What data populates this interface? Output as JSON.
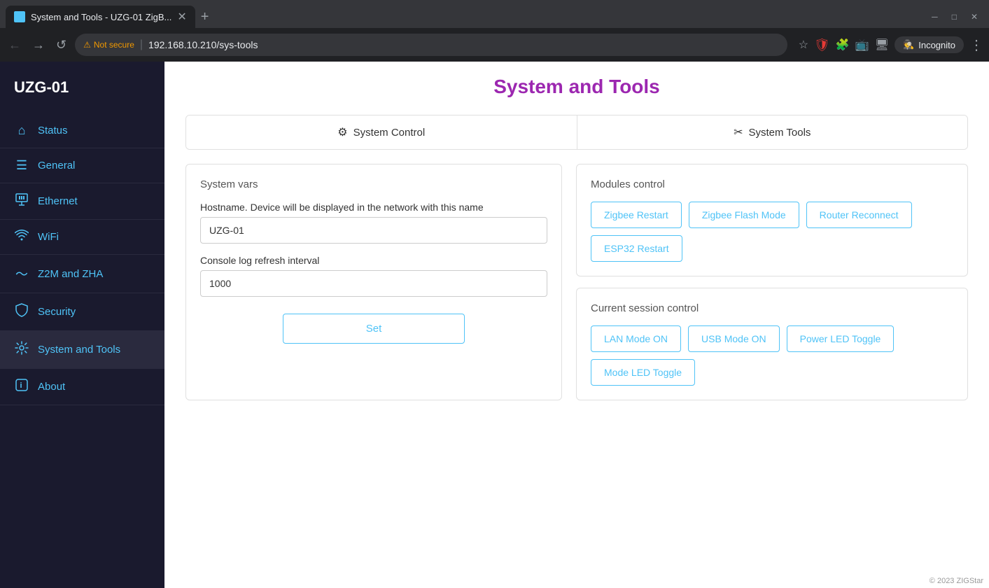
{
  "browser": {
    "tab_title": "System and Tools - UZG-01 ZigB...",
    "new_tab_icon": "+",
    "url": "192.168.10.210/sys-tools",
    "not_secure_label": "Not secure",
    "incognito_label": "Incognito"
  },
  "sidebar": {
    "logo": "UZG-01",
    "items": [
      {
        "id": "status",
        "label": "Status",
        "icon": "⌂"
      },
      {
        "id": "general",
        "label": "General",
        "icon": "☰"
      },
      {
        "id": "ethernet",
        "label": "Ethernet",
        "icon": "🖧"
      },
      {
        "id": "wifi",
        "label": "WiFi",
        "icon": "📶"
      },
      {
        "id": "z2m-zha",
        "label": "Z2M and ZHA",
        "icon": "⌇"
      },
      {
        "id": "security",
        "label": "Security",
        "icon": "🔒"
      },
      {
        "id": "system-tools",
        "label": "System and Tools",
        "icon": "⚙"
      },
      {
        "id": "about",
        "label": "About",
        "icon": "ℹ"
      }
    ]
  },
  "page": {
    "title": "System and Tools",
    "tabs": [
      {
        "id": "system-control",
        "label": "System Control",
        "icon": "⚙",
        "active": true
      },
      {
        "id": "system-tools",
        "label": "System Tools",
        "icon": "✂"
      }
    ]
  },
  "system_vars": {
    "section_title": "System vars",
    "hostname_label": "Hostname. Device will be displayed in the network with this name",
    "hostname_value": "UZG-01",
    "console_label": "Console log refresh interval",
    "console_value": "1000",
    "set_button_label": "Set"
  },
  "modules_control": {
    "section_title": "Modules control",
    "buttons": [
      {
        "id": "zigbee-restart",
        "label": "Zigbee Restart"
      },
      {
        "id": "zigbee-flash-mode",
        "label": "Zigbee Flash Mode"
      },
      {
        "id": "router-reconnect",
        "label": "Router Reconnect"
      },
      {
        "id": "esp32-restart",
        "label": "ESP32 Restart"
      }
    ]
  },
  "session_control": {
    "section_title": "Current session control",
    "buttons": [
      {
        "id": "lan-mode-on",
        "label": "LAN Mode ON"
      },
      {
        "id": "usb-mode-on",
        "label": "USB Mode ON"
      },
      {
        "id": "power-led-toggle",
        "label": "Power LED Toggle"
      },
      {
        "id": "mode-led-toggle",
        "label": "Mode LED Toggle"
      }
    ]
  },
  "footer": {
    "label": "© 2023 ZIGStar"
  }
}
